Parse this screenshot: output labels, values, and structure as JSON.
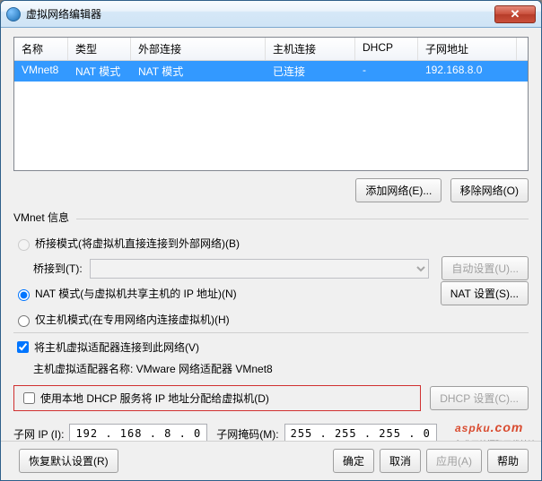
{
  "window": {
    "title": "虚拟网络编辑器"
  },
  "grid": {
    "headers": {
      "name": "名称",
      "type": "类型",
      "ext": "外部连接",
      "host": "主机连接",
      "dhcp": "DHCP",
      "subnet": "子网地址"
    },
    "row": {
      "name": "VMnet8",
      "type": "NAT 模式",
      "ext": "NAT 模式",
      "host": "已连接",
      "dhcp": "-",
      "subnet": "192.168.8.0"
    }
  },
  "buttons": {
    "add_net": "添加网络(E)...",
    "remove_net": "移除网络(O)",
    "auto_set": "自动设置(U)...",
    "nat_set": "NAT 设置(S)...",
    "dhcp_set": "DHCP 设置(C)...",
    "restore": "恢复默认设置(R)",
    "ok": "确定",
    "cancel": "取消",
    "apply": "应用(A)",
    "help": "帮助"
  },
  "group": {
    "title": "VMnet 信息",
    "bridge_radio": "桥接模式(将虚拟机直接连接到外部网络)(B)",
    "bridge_to": "桥接到(T):",
    "nat_radio": "NAT 模式(与虚拟机共享主机的 IP 地址)(N)",
    "hostonly_radio": "仅主机模式(在专用网络内连接虚拟机)(H)",
    "connect_host": "将主机虚拟适配器连接到此网络(V)",
    "adapter_label": "主机虚拟适配器名称: VMware 网络适配器 VMnet8",
    "use_dhcp": "使用本地 DHCP 服务将 IP 地址分配给虚拟机(D)",
    "subnet_ip_label": "子网 IP (I):",
    "subnet_ip": "192 . 168 .  8  .  0",
    "subnet_mask_label": "子网掩码(M):",
    "subnet_mask": "255 . 255 . 255 .  0"
  },
  "watermark": {
    "brand": "aspku",
    "suffix": ".com",
    "sub": "免费网站源码下载基地"
  }
}
